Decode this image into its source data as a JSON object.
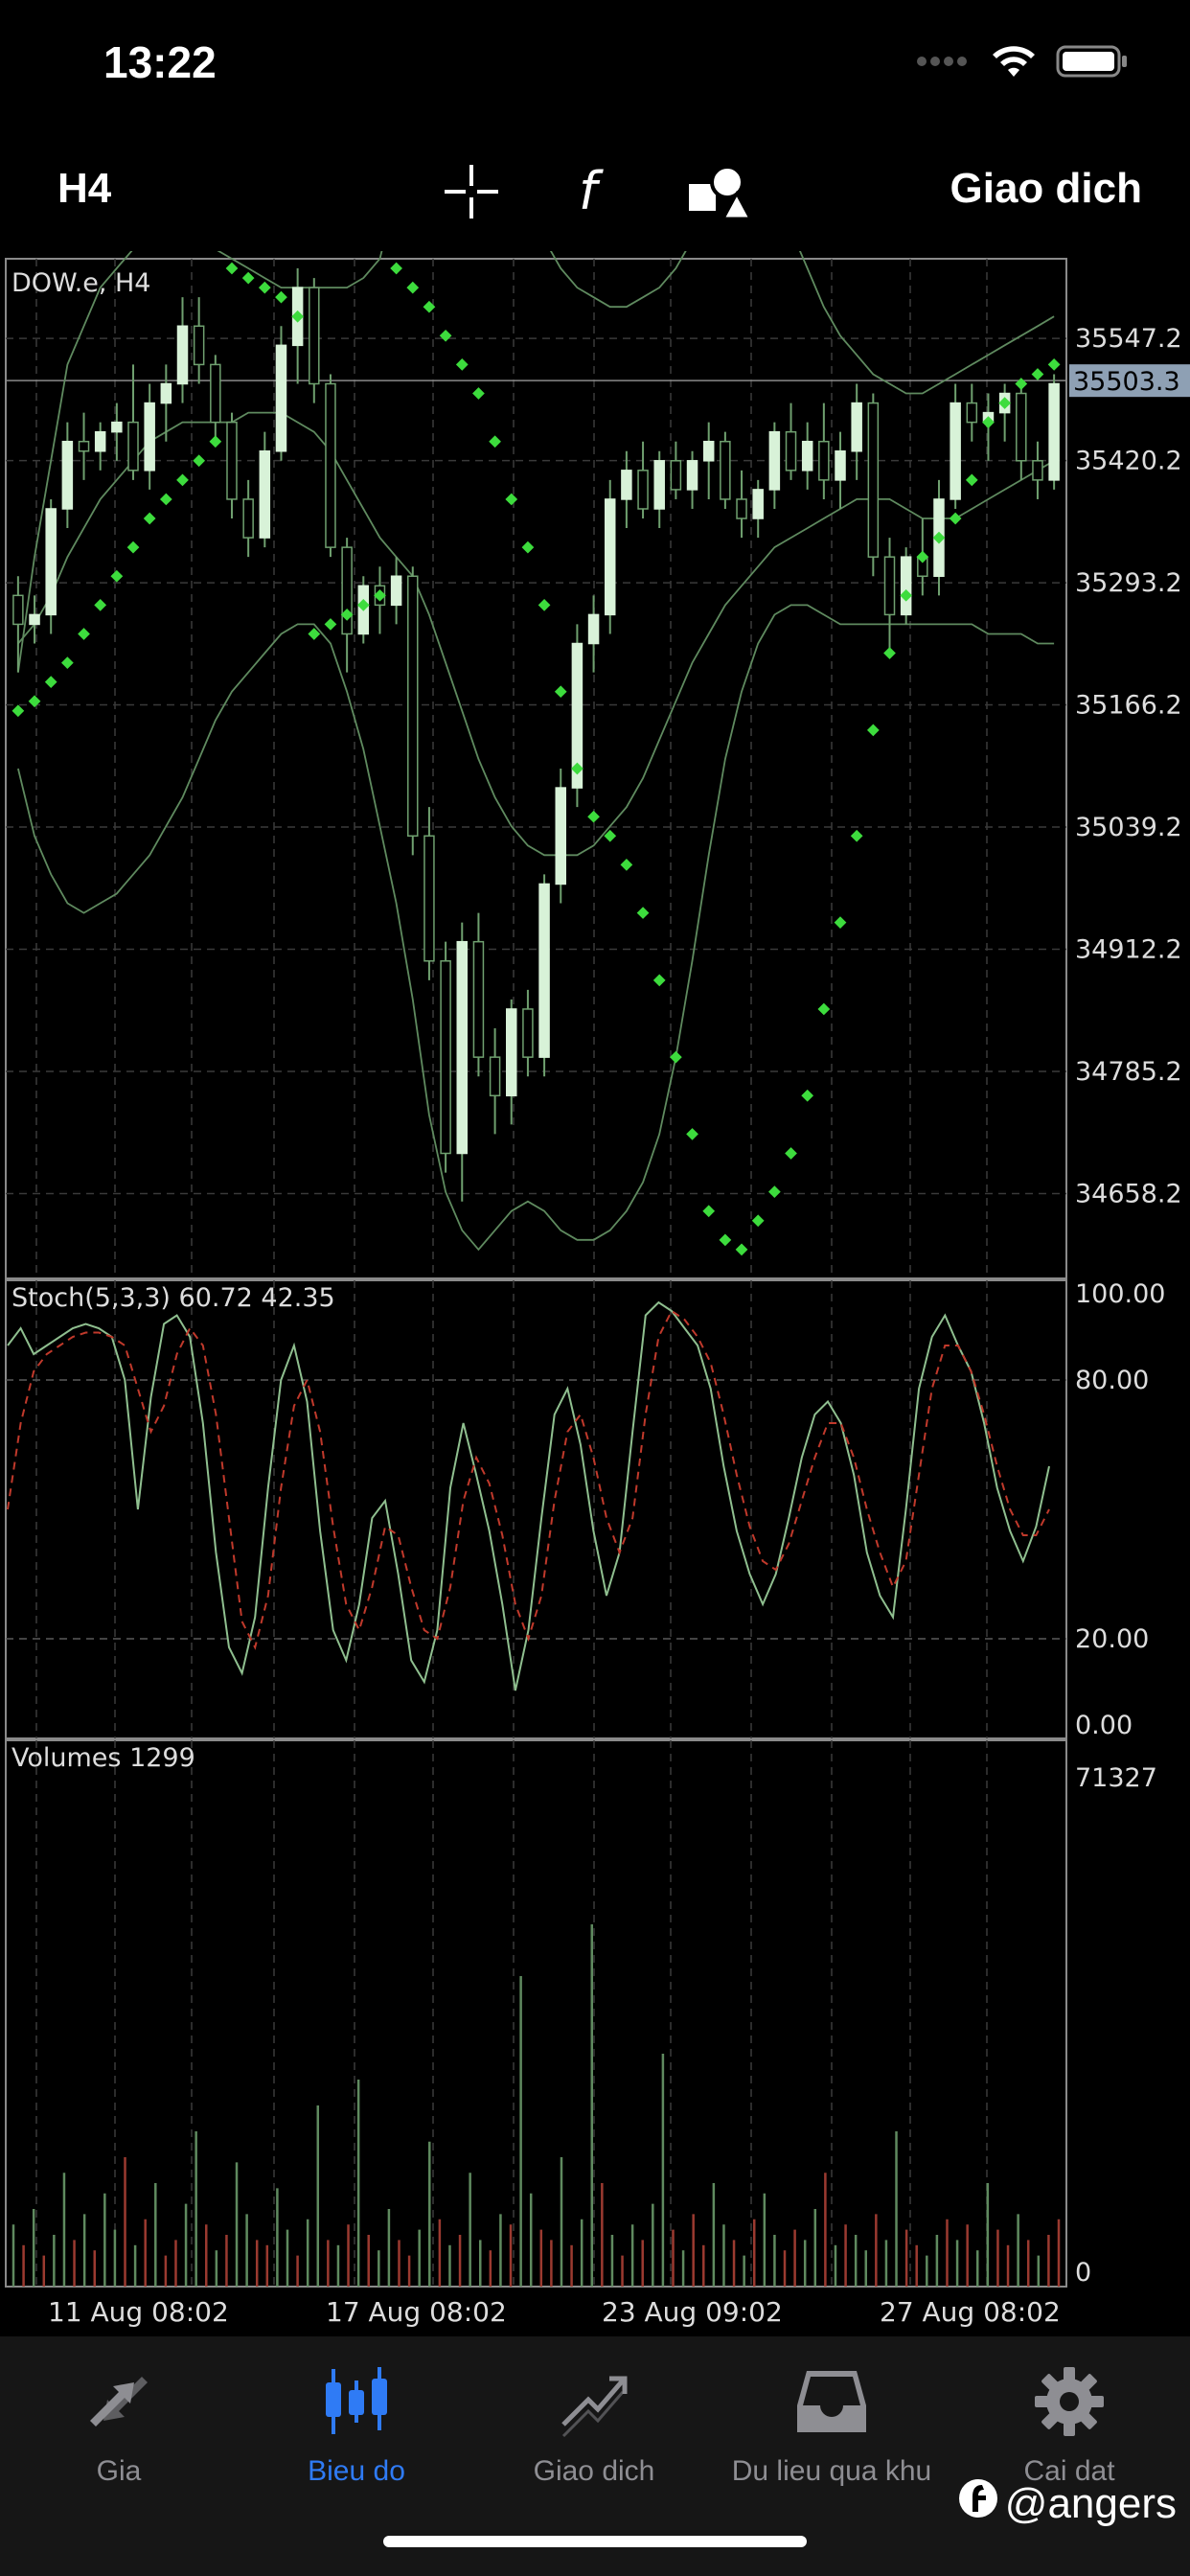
{
  "status": {
    "time": "13:22"
  },
  "toolbar": {
    "period": "H4",
    "trade_label": "Giao dich"
  },
  "chart_data": [
    {
      "type": "candlestick",
      "title": "DOW.e, H4",
      "ylim": [
        34570,
        35630
      ],
      "y_ticks": [
        "35547.2",
        "35420.2",
        "35293.2",
        "35166.2",
        "35039.2",
        "34912.2",
        "34785.2",
        "34658.2"
      ],
      "y_tick_values": [
        35547.2,
        35420.2,
        35293.2,
        35166.2,
        35039.2,
        34912.2,
        34785.2,
        34658.2
      ],
      "current_price_label": "35503.3",
      "current_price": 35503.3,
      "candles": [
        [
          35280,
          35300,
          35200,
          35250
        ],
        [
          35250,
          35280,
          35230,
          35260
        ],
        [
          35260,
          35380,
          35240,
          35370
        ],
        [
          35370,
          35460,
          35350,
          35440
        ],
        [
          35440,
          35470,
          35400,
          35430
        ],
        [
          35430,
          35460,
          35410,
          35450
        ],
        [
          35450,
          35480,
          35420,
          35460
        ],
        [
          35460,
          35520,
          35400,
          35410
        ],
        [
          35410,
          35500,
          35390,
          35480
        ],
        [
          35480,
          35520,
          35440,
          35500
        ],
        [
          35500,
          35590,
          35480,
          35560
        ],
        [
          35560,
          35590,
          35500,
          35520
        ],
        [
          35520,
          35530,
          35440,
          35460
        ],
        [
          35460,
          35470,
          35360,
          35380
        ],
        [
          35380,
          35400,
          35320,
          35340
        ],
        [
          35340,
          35450,
          35330,
          35430
        ],
        [
          35430,
          35560,
          35420,
          35540
        ],
        [
          35540,
          35620,
          35500,
          35600
        ],
        [
          35600,
          35610,
          35480,
          35500
        ],
        [
          35500,
          35510,
          35320,
          35330
        ],
        [
          35330,
          35340,
          35200,
          35240
        ],
        [
          35240,
          35300,
          35230,
          35290
        ],
        [
          35290,
          35310,
          35240,
          35270
        ],
        [
          35270,
          35320,
          35250,
          35300
        ],
        [
          35300,
          35310,
          35010,
          35030
        ],
        [
          35030,
          35060,
          34880,
          34900
        ],
        [
          34900,
          34920,
          34680,
          34700
        ],
        [
          34700,
          34940,
          34650,
          34920
        ],
        [
          34920,
          34950,
          34780,
          34800
        ],
        [
          34800,
          34830,
          34720,
          34760
        ],
        [
          34760,
          34860,
          34730,
          34850
        ],
        [
          34850,
          34870,
          34780,
          34800
        ],
        [
          34800,
          34990,
          34780,
          34980
        ],
        [
          34980,
          35100,
          34960,
          35080
        ],
        [
          35080,
          35250,
          35060,
          35230
        ],
        [
          35230,
          35280,
          35200,
          35260
        ],
        [
          35260,
          35400,
          35240,
          35380
        ],
        [
          35380,
          35430,
          35350,
          35410
        ],
        [
          35410,
          35440,
          35360,
          35370
        ],
        [
          35370,
          35430,
          35350,
          35420
        ],
        [
          35420,
          35440,
          35380,
          35390
        ],
        [
          35390,
          35430,
          35370,
          35420
        ],
        [
          35420,
          35460,
          35380,
          35440
        ],
        [
          35440,
          35450,
          35370,
          35380
        ],
        [
          35380,
          35410,
          35340,
          35360
        ],
        [
          35360,
          35400,
          35340,
          35390
        ],
        [
          35390,
          35460,
          35370,
          35450
        ],
        [
          35450,
          35480,
          35400,
          35410
        ],
        [
          35410,
          35460,
          35390,
          35440
        ],
        [
          35440,
          35480,
          35380,
          35400
        ],
        [
          35400,
          35450,
          35370,
          35430
        ],
        [
          35430,
          35500,
          35400,
          35480
        ],
        [
          35480,
          35490,
          35300,
          35320
        ],
        [
          35320,
          35340,
          35220,
          35260
        ],
        [
          35260,
          35330,
          35250,
          35320
        ],
        [
          35320,
          35360,
          35280,
          35300
        ],
        [
          35300,
          35400,
          35280,
          35380
        ],
        [
          35380,
          35500,
          35370,
          35480
        ],
        [
          35480,
          35500,
          35440,
          35460
        ],
        [
          35460,
          35490,
          35420,
          35470
        ],
        [
          35470,
          35500,
          35440,
          35490
        ],
        [
          35490,
          35500,
          35400,
          35420
        ],
        [
          35420,
          35440,
          35380,
          35400
        ],
        [
          35400,
          35510,
          35390,
          35500
        ]
      ],
      "sar": [
        35160,
        35170,
        35190,
        35210,
        35240,
        35270,
        35300,
        35330,
        35360,
        35380,
        35400,
        35420,
        35440,
        35620,
        35610,
        35600,
        35590,
        35570,
        35240,
        35250,
        35260,
        35270,
        35280,
        35620,
        35600,
        35580,
        35550,
        35520,
        35490,
        35440,
        35380,
        35330,
        35270,
        35180,
        35100,
        35050,
        35030,
        35000,
        34950,
        34880,
        34800,
        34720,
        34640,
        34610,
        34600,
        34630,
        34660,
        34700,
        34760,
        34850,
        34940,
        35030,
        35140,
        35220,
        35280,
        35320,
        35340,
        35360,
        35400,
        35460,
        35480,
        35500,
        35510,
        35520
      ],
      "bollinger_upper": [
        35200,
        35320,
        35420,
        35520,
        35560,
        35600,
        35620,
        35640,
        35650,
        35660,
        35660,
        35650,
        35640,
        35630,
        35620,
        35610,
        35600,
        35600,
        35600,
        35600,
        35600,
        35610,
        35630,
        35700,
        35760,
        35820,
        35860,
        35880,
        35860,
        35820,
        35760,
        35700,
        35650,
        35620,
        35600,
        35590,
        35580,
        35580,
        35590,
        35600,
        35620,
        35650,
        35680,
        35700,
        35720,
        35720,
        35700,
        35660,
        35620,
        35580,
        35550,
        35530,
        35510,
        35500,
        35490,
        35490,
        35500,
        35510,
        35520,
        35530,
        35540,
        35550,
        35560,
        35570
      ],
      "bollinger_mid": [
        35230,
        35250,
        35280,
        35320,
        35350,
        35380,
        35400,
        35420,
        35440,
        35450,
        35460,
        35460,
        35460,
        35460,
        35470,
        35470,
        35470,
        35460,
        35450,
        35430,
        35400,
        35370,
        35340,
        35320,
        35300,
        35260,
        35210,
        35160,
        35110,
        35070,
        35040,
        35020,
        35010,
        35010,
        35010,
        35020,
        35040,
        35060,
        35090,
        35130,
        35170,
        35210,
        35240,
        35270,
        35290,
        35310,
        35330,
        35340,
        35350,
        35360,
        35370,
        35380,
        35380,
        35380,
        35370,
        35360,
        35360,
        35360,
        35370,
        35380,
        35390,
        35400,
        35410,
        35420
      ],
      "bollinger_lower": [
        35100,
        35030,
        34990,
        34960,
        34950,
        34960,
        34970,
        34990,
        35010,
        35040,
        35070,
        35110,
        35150,
        35180,
        35200,
        35220,
        35240,
        35250,
        35250,
        35230,
        35180,
        35120,
        35040,
        34960,
        34860,
        34740,
        34660,
        34620,
        34600,
        34620,
        34640,
        34650,
        34640,
        34620,
        34610,
        34610,
        34620,
        34640,
        34670,
        34720,
        34800,
        34900,
        35010,
        35110,
        35180,
        35230,
        35260,
        35270,
        35270,
        35260,
        35250,
        35250,
        35250,
        35250,
        35250,
        35250,
        35250,
        35250,
        35250,
        35240,
        35240,
        35240,
        35230,
        35230
      ]
    },
    {
      "type": "line",
      "title": "Stoch(5,3,3) 60.72 42.35",
      "ylim": [
        0,
        100
      ],
      "y_ticks": [
        "100.00",
        "80.00",
        "20.00",
        "0.00"
      ],
      "y_tick_values": [
        100,
        80,
        20,
        0
      ],
      "series": [
        {
          "name": "main",
          "values": [
            88,
            92,
            86,
            88,
            90,
            92,
            93,
            92,
            90,
            80,
            50,
            76,
            93,
            95,
            90,
            70,
            40,
            18,
            12,
            25,
            55,
            80,
            88,
            75,
            45,
            22,
            15,
            28,
            48,
            52,
            35,
            15,
            10,
            22,
            55,
            70,
            58,
            45,
            28,
            8,
            22,
            48,
            72,
            78,
            65,
            45,
            30,
            40,
            68,
            95,
            98,
            96,
            92,
            88,
            78,
            60,
            45,
            35,
            28,
            35,
            48,
            62,
            72,
            75,
            70,
            58,
            40,
            30,
            25,
            50,
            78,
            90,
            95,
            88,
            82,
            70,
            55,
            45,
            38,
            46,
            60
          ]
        },
        {
          "name": "signal",
          "values": [
            50,
            70,
            82,
            86,
            88,
            90,
            91,
            91,
            90,
            88,
            78,
            68,
            74,
            86,
            92,
            88,
            72,
            48,
            24,
            18,
            30,
            55,
            74,
            80,
            68,
            46,
            28,
            22,
            32,
            46,
            44,
            32,
            22,
            20,
            32,
            52,
            62,
            56,
            44,
            28,
            20,
            30,
            52,
            68,
            72,
            62,
            48,
            40,
            48,
            72,
            90,
            96,
            94,
            90,
            84,
            72,
            58,
            46,
            38,
            36,
            42,
            52,
            62,
            70,
            70,
            62,
            50,
            40,
            32,
            38,
            58,
            78,
            88,
            88,
            82,
            72,
            60,
            50,
            44,
            44,
            50
          ]
        }
      ]
    },
    {
      "type": "bar",
      "title": "Volumes 1299",
      "ylim": [
        0,
        71327
      ],
      "y_ticks": [
        "71327",
        "0"
      ],
      "y_tick_values": [
        71327,
        0
      ],
      "x_tick_labels": [
        "11 Aug 08:02",
        "17 Aug 08:02",
        "23 Aug 09:02",
        "27 Aug 08:02"
      ],
      "values": [
        12,
        8,
        15,
        6,
        10,
        22,
        9,
        14,
        7,
        18,
        11,
        25,
        8,
        13,
        20,
        6,
        9,
        16,
        30,
        12,
        7,
        10,
        24,
        14,
        9,
        8,
        19,
        11,
        6,
        13,
        35,
        9,
        8,
        12,
        40,
        10,
        7,
        15,
        9,
        6,
        11,
        28,
        13,
        8,
        10,
        22,
        9,
        7,
        14,
        12,
        60,
        18,
        11,
        9,
        25,
        8,
        13,
        70,
        20,
        10,
        6,
        12,
        9,
        16,
        45,
        11,
        7,
        14,
        8,
        20,
        12,
        9,
        6,
        13,
        18,
        10,
        7,
        11,
        9,
        15,
        22,
        8,
        12,
        10,
        7,
        14,
        9,
        30,
        11,
        8,
        6,
        10,
        13,
        9,
        12,
        7,
        20,
        11,
        8,
        14,
        9,
        6,
        10,
        13
      ],
      "up": [
        1,
        0,
        1,
        0,
        1,
        1,
        0,
        1,
        0,
        1,
        1,
        0,
        1,
        0,
        1,
        0,
        0,
        1,
        1,
        0,
        1,
        0,
        1,
        1,
        0,
        0,
        1,
        1,
        0,
        1,
        1,
        0,
        1,
        0,
        1,
        0,
        1,
        1,
        0,
        0,
        1,
        1,
        0,
        1,
        0,
        1,
        1,
        0,
        1,
        0,
        1,
        1,
        0,
        0,
        1,
        0,
        1,
        1,
        0,
        1,
        0,
        1,
        0,
        1,
        1,
        0,
        1,
        0,
        0,
        1,
        1,
        0,
        1,
        0,
        1,
        1,
        0,
        0,
        1,
        1,
        0,
        1,
        0,
        1,
        1,
        0,
        1,
        1,
        0,
        0,
        1,
        1,
        0,
        1,
        0,
        1,
        1,
        0,
        0,
        1,
        0,
        1,
        0
      ]
    }
  ],
  "tabs": [
    {
      "label": "Gia"
    },
    {
      "label": "Bieu do"
    },
    {
      "label": "Giao dich"
    },
    {
      "label": "Du lieu qua khu"
    },
    {
      "label": "Cai dat"
    }
  ],
  "watermark": "@angers"
}
